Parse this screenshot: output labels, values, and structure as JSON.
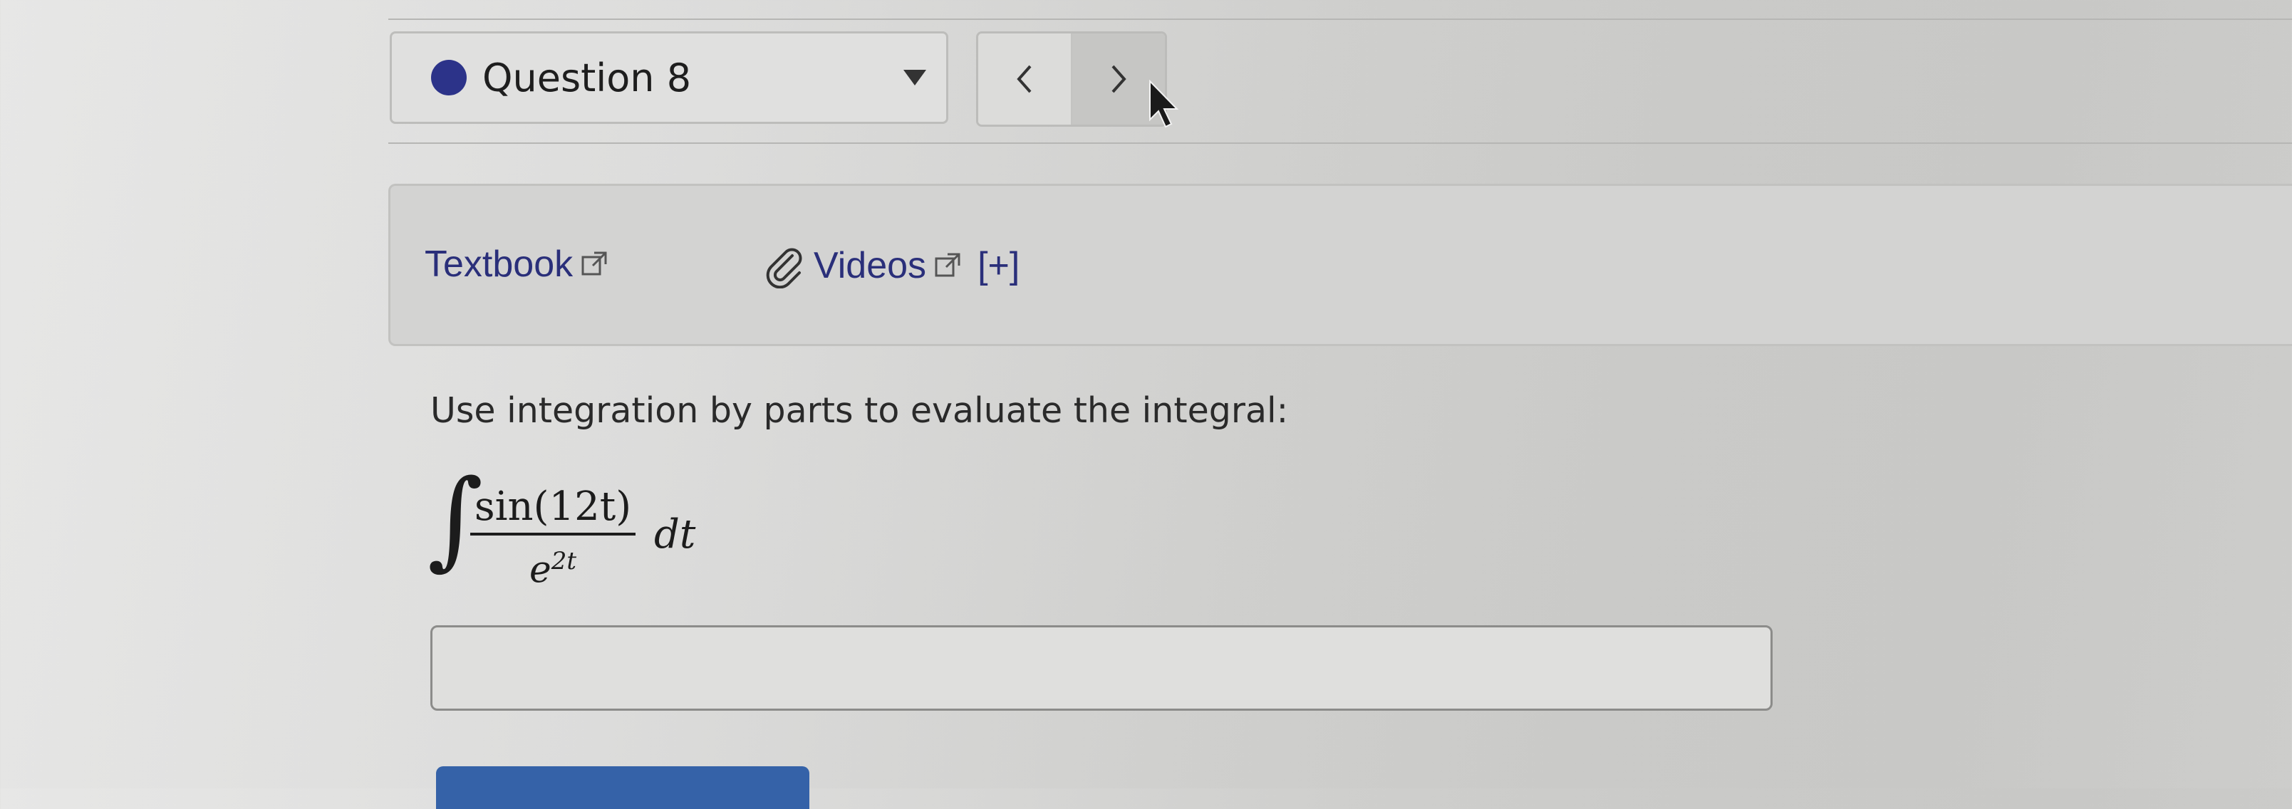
{
  "question_selector": {
    "label": "Question 8",
    "status_color": "#2c3389"
  },
  "navigation": {
    "prev_icon": "chevron-left-icon",
    "next_icon": "chevron-right-icon"
  },
  "resources": {
    "textbook_label": "Textbook",
    "videos_label": "Videos",
    "expand_label": "[+]",
    "link_color": "#2a2f7a"
  },
  "problem": {
    "prompt": "Use integration by parts to evaluate the integral:",
    "integral": {
      "sign": "∫",
      "numerator": "sin(12t)",
      "denominator_base": "e",
      "denominator_exponent": "2t",
      "differential": "dt"
    }
  },
  "answer": {
    "value": "",
    "placeholder": ""
  },
  "submit": {
    "label": "",
    "color": "#3562a8"
  }
}
